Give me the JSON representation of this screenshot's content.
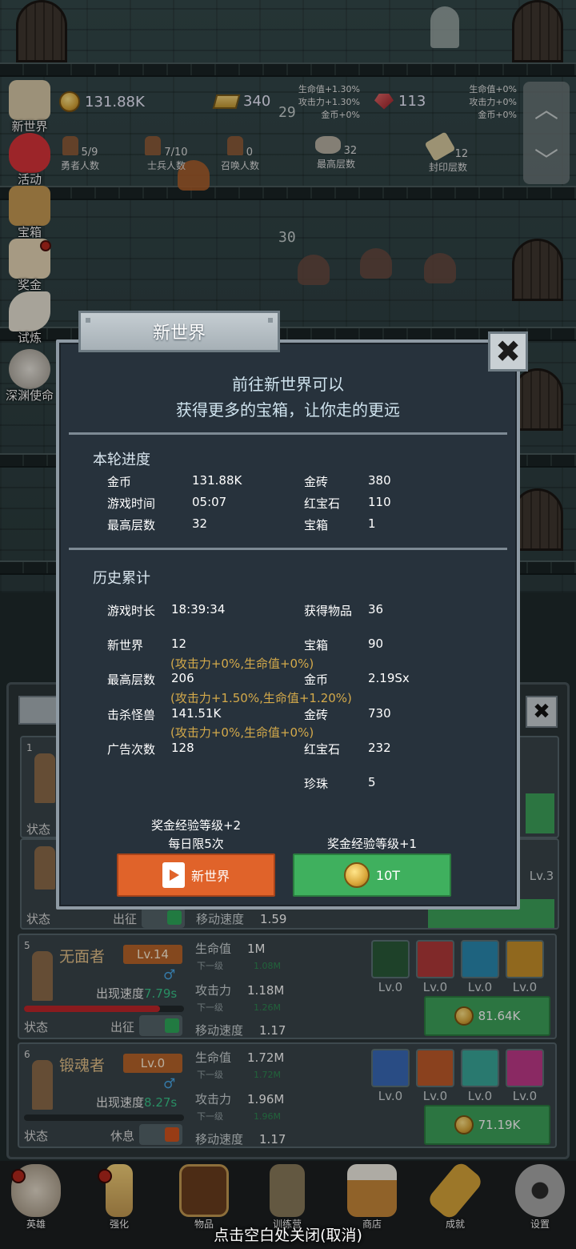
{
  "hud": {
    "gold": "131.88K",
    "gold_bars": "340",
    "rubies": "113",
    "left_bonus": [
      "生命值+1.30%",
      "攻击力+1.30%",
      "金币+0%"
    ],
    "right_bonus": [
      "生命值+0%",
      "攻击力+0%",
      "金币+0%"
    ],
    "current_floor": "29",
    "next_floor": "30",
    "hero_count": "5/9",
    "hero_count_label": "勇者人数",
    "soldier_count": "7/10",
    "soldier_count_label": "士兵人数",
    "summon_count": "0",
    "summon_count_label": "召唤人数",
    "max_floor": "32",
    "max_floor_label": "最高层数",
    "sealed_floor": "12",
    "sealed_floor_label": "封印层数"
  },
  "side_arrows": {
    "up": "︿",
    "down": "﹀"
  },
  "left_nav": [
    {
      "label": "新世界",
      "icon": "map-icon"
    },
    {
      "label": "活动",
      "icon": "heart-icon"
    },
    {
      "label": "宝箱",
      "icon": "chest-icon"
    },
    {
      "label": "奖金",
      "icon": "letter-icon"
    },
    {
      "label": "试炼",
      "icon": "feather-icon"
    },
    {
      "label": "深渊使命",
      "icon": "orb-icon"
    }
  ],
  "modal": {
    "title": "新世界",
    "close_glyph": "✖",
    "intro_line1": "前往新世界可以",
    "intro_line2": "获得更多的宝箱，让你走的更远",
    "round_title": "本轮进度",
    "round": [
      {
        "k": "金币",
        "v": "131.88K"
      },
      {
        "k": "金砖",
        "v": "380"
      },
      {
        "k": "游戏时间",
        "v": "05:07"
      },
      {
        "k": "红宝石",
        "v": "110"
      },
      {
        "k": "最高层数",
        "v": "32"
      },
      {
        "k": "宝箱",
        "v": "1"
      }
    ],
    "history_title": "历史累计",
    "history": {
      "play_time": {
        "k": "游戏时长",
        "v": "18:39:34"
      },
      "items": {
        "k": "获得物品",
        "v": "36"
      },
      "new_world": {
        "k": "新世界",
        "v": "12",
        "note": "(攻击力+0%,生命值+0%)"
      },
      "chests": {
        "k": "宝箱",
        "v": "90"
      },
      "max_floor": {
        "k": "最高层数",
        "v": "206",
        "note": "(攻击力+1.50%,生命值+1.20%)"
      },
      "gold": {
        "k": "金币",
        "v": "2.19Sx"
      },
      "kills": {
        "k": "击杀怪兽",
        "v": "141.51K",
        "note": "(攻击力+0%,生命值+0%)"
      },
      "bricks": {
        "k": "金砖",
        "v": "730"
      },
      "ads": {
        "k": "广告次数",
        "v": "128"
      },
      "rubies": {
        "k": "红宝石",
        "v": "232"
      },
      "pearls": {
        "k": "珍珠",
        "v": "5"
      }
    },
    "left_caption1": "奖金经验等级+2",
    "left_caption2": "每日限5次",
    "right_caption": "奖金经验等级+1",
    "btn_video": "新世界",
    "btn_coin": "10T"
  },
  "hero_cards": [
    {
      "index": "5",
      "name": "无面者",
      "level": "Lv.14",
      "gender": "♂",
      "spawn_label": "出现速度",
      "spawn": "7.79s",
      "hp_ratio": 0.85,
      "status_label": "状态",
      "state": "出征",
      "toggle_color": "#2faa5a",
      "hp_label": "生命值",
      "hp": "1M",
      "next_label": "下一级",
      "hp_next": "1.08M",
      "atk_label": "攻击力",
      "atk": "1.18M",
      "atk_next": "1.26M",
      "spd_label": "移动速度",
      "spd": "1.17",
      "equip": [
        {
          "lv": "Lv.0",
          "icon": "sword-shield-icon"
        },
        {
          "lv": "Lv.0",
          "icon": "sword-icon"
        },
        {
          "lv": "Lv.0",
          "icon": "boot-icon"
        },
        {
          "lv": "Lv.0",
          "icon": "helmet-icon"
        }
      ],
      "price": "81.64K"
    },
    {
      "index": "6",
      "name": "锻魂者",
      "level": "Lv.0",
      "gender": "♂",
      "spawn_label": "出现速度",
      "spawn": "8.27s",
      "hp_ratio": 0,
      "status_label": "状态",
      "state": "休息",
      "toggle_color": "#d3541e",
      "hp_label": "生命值",
      "hp": "1.72M",
      "next_label": "下一级",
      "hp_next": "1.72M",
      "atk_label": "攻击力",
      "atk": "1.96M",
      "atk_next": "1.96M",
      "spd_label": "移动速度",
      "spd": "1.17",
      "equip": [
        {
          "lv": "Lv.0",
          "icon": "skull-shield-icon"
        },
        {
          "lv": "Lv.0",
          "icon": "axe-icon"
        },
        {
          "lv": "Lv.0",
          "icon": "hammer-icon"
        },
        {
          "lv": "Lv.0",
          "icon": "boot-icon"
        }
      ],
      "price": "71.19K"
    }
  ],
  "partial_card": {
    "index": "1",
    "status_label": "状态",
    "state": "出征",
    "spd_label": "移动速度",
    "spd": "1.59",
    "equip_lv": "Lv.3",
    "close_glyph": "✖"
  },
  "bottom_nav": [
    {
      "label": "英雄",
      "icon": "skull-icon"
    },
    {
      "label": "强化",
      "icon": "candle-icon"
    },
    {
      "label": "物品",
      "icon": "book-icon"
    },
    {
      "label": "训练营",
      "icon": "lantern-icon"
    },
    {
      "label": "商店",
      "icon": "mug-icon"
    },
    {
      "label": "成就",
      "icon": "key-icon"
    },
    {
      "label": "设置",
      "icon": "gear-icon"
    }
  ],
  "close_hint": "点击空白处关闭(取消)"
}
